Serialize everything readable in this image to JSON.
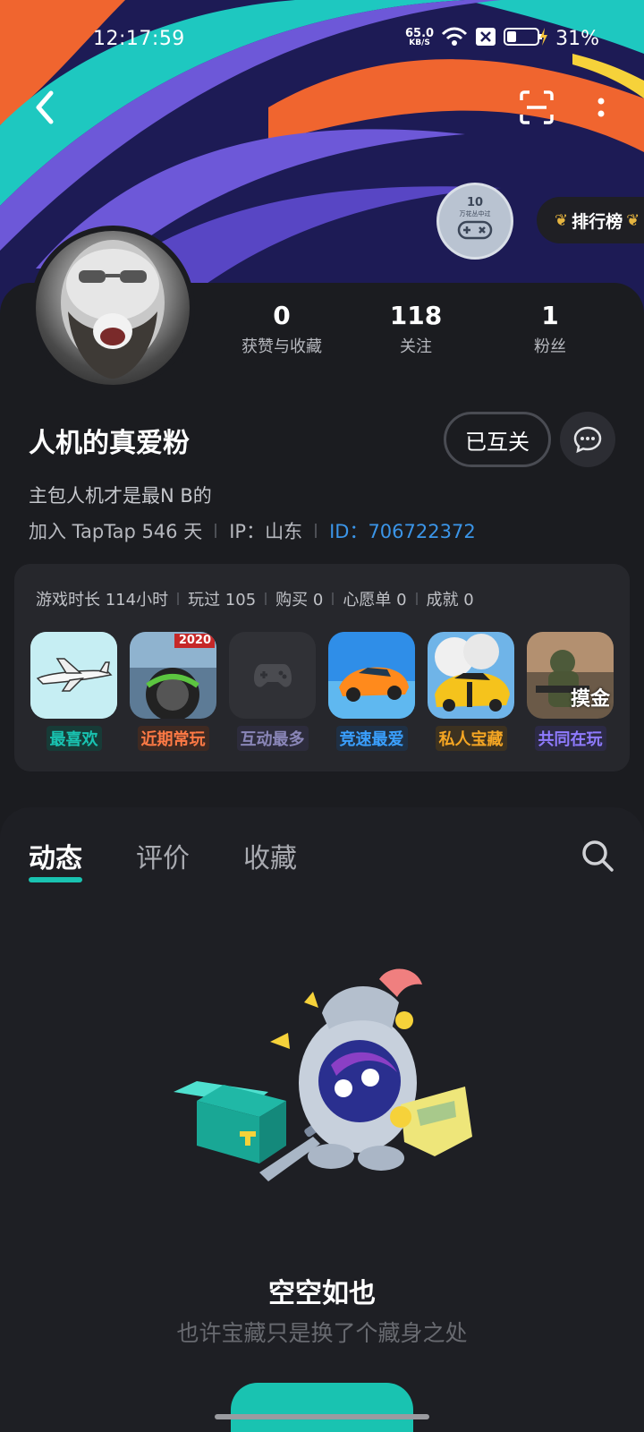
{
  "status_bar": {
    "time": "12:17:59",
    "net_speed_value": "65.0",
    "net_speed_unit": "KB/S",
    "battery_percent": "31%"
  },
  "profile": {
    "level_number": "10",
    "level_caption": "万花丛中过",
    "rank_label": "排行榜",
    "username": "人机的真爱粉",
    "mutual_label": "已互关",
    "bio": "主包人机才是最N B的",
    "joined": "加入 TapTap 546 天",
    "ip": "IP：山东",
    "user_id": "ID：706722372"
  },
  "stats": [
    {
      "value": "0",
      "label": "获赞与收藏"
    },
    {
      "value": "118",
      "label": "关注"
    },
    {
      "value": "1",
      "label": "粉丝"
    }
  ],
  "games_stats": [
    "游戏时长 114小时",
    "玩过 105",
    "购买 0",
    "心愿单 0",
    "成就 0"
  ],
  "games": [
    {
      "tag": "最喜欢",
      "tag_color": "#19c3b1",
      "tag_bg": "#173b37",
      "icon_label": ""
    },
    {
      "tag": "近期常玩",
      "tag_color": "#ff7a45",
      "tag_bg": "#3f2a22",
      "icon_label": "2020"
    },
    {
      "tag": "互动最多",
      "tag_color": "#8a86b8",
      "tag_bg": "#2d2c3c",
      "icon_label": ""
    },
    {
      "tag": "竞速最爱",
      "tag_color": "#3aa0ff",
      "tag_bg": "#1f3044",
      "icon_label": ""
    },
    {
      "tag": "私人宝藏",
      "tag_color": "#f5a623",
      "tag_bg": "#3d3220",
      "icon_label": ""
    },
    {
      "tag": "共同在玩",
      "tag_color": "#8f7bff",
      "tag_bg": "#2c2a45",
      "icon_label": "摸金"
    }
  ],
  "tabs": [
    "动态",
    "评价",
    "收藏"
  ],
  "empty_state": {
    "title": "空空如也",
    "subtitle": "也许宝藏只是换了个藏身之处"
  },
  "colors": {
    "accent": "#19c3b1",
    "link": "#3b95e8",
    "background": "#1b1c20"
  }
}
